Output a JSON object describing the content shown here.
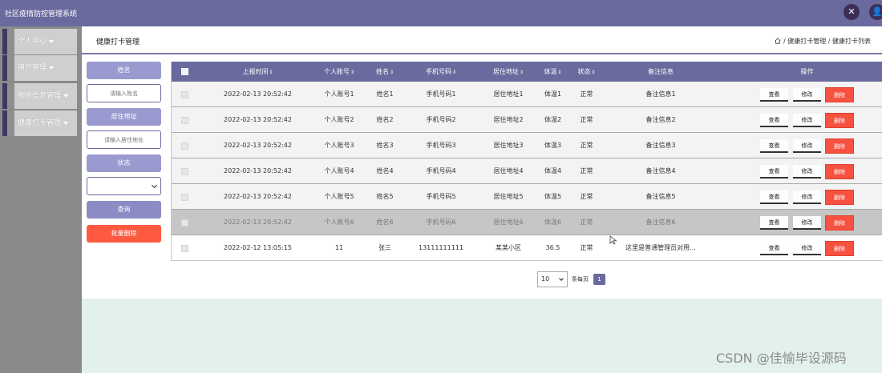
{
  "app": {
    "title": "社区疫情防控管理系统"
  },
  "top_icons": [
    {
      "icon": "expand-icon"
    },
    {
      "icon": "user-icon"
    }
  ],
  "sidebar": {
    "items": [
      {
        "label": "个人中心"
      },
      {
        "label": "用户管理"
      },
      {
        "label": "物资信息管理"
      },
      {
        "label": "健康打卡管理"
      }
    ]
  },
  "header": {
    "title": "健康打卡管理",
    "breadcrumb": "/ 健康打卡管理 / 健康打卡列表"
  },
  "search": {
    "name_label": "姓名",
    "name_placeholder": "请输入姓名",
    "address_label": "居住地址",
    "address_placeholder": "请输入居住地址",
    "status_label": "状态",
    "status_value": "",
    "query_button": "查询",
    "batch_delete_button": "批量删除"
  },
  "table": {
    "columns": [
      "上报时间",
      "个人账号",
      "姓名",
      "手机号码",
      "居住地址",
      "体温",
      "状态",
      "备注信息",
      "操作"
    ],
    "rows": [
      {
        "time": "2022-02-13 20:52:42",
        "account": "个人账号1",
        "name": "姓名1",
        "phone": "手机号码1",
        "address": "居住地址1",
        "temp": "体温1",
        "status": "正常",
        "note": "备注信息1"
      },
      {
        "time": "2022-02-13 20:52:42",
        "account": "个人账号2",
        "name": "姓名2",
        "phone": "手机号码2",
        "address": "居住地址2",
        "temp": "体温2",
        "status": "正常",
        "note": "备注信息2"
      },
      {
        "time": "2022-02-13 20:52:42",
        "account": "个人账号3",
        "name": "姓名3",
        "phone": "手机号码3",
        "address": "居住地址3",
        "temp": "体温3",
        "status": "正常",
        "note": "备注信息3"
      },
      {
        "time": "2022-02-13 20:52:42",
        "account": "个人账号4",
        "name": "姓名4",
        "phone": "手机号码4",
        "address": "居住地址4",
        "temp": "体温4",
        "status": "正常",
        "note": "备注信息4"
      },
      {
        "time": "2022-02-13 20:52:42",
        "account": "个人账号5",
        "name": "姓名5",
        "phone": "手机号码5",
        "address": "居住地址5",
        "temp": "体温5",
        "status": "正常",
        "note": "备注信息5"
      },
      {
        "time": "2022-02-13 20:52:42",
        "account": "个人账号6",
        "name": "姓名6",
        "phone": "手机号码6",
        "address": "居住地址6",
        "temp": "体温6",
        "status": "正常",
        "note": "备注信息6"
      },
      {
        "time": "2022-02-12 13:05:15",
        "account": "11",
        "name": "张三",
        "phone": "13111111111",
        "address": "某某小区",
        "temp": "36.5",
        "status": "正常",
        "note": "这里是普通管理员对用..."
      }
    ],
    "actions": {
      "view": "查看",
      "edit": "修改",
      "delete": "删除"
    }
  },
  "pagination": {
    "page_size": "10",
    "per_page_label": "条每页",
    "current_page": "1"
  },
  "watermark": "CSDN @佳愉毕设源码",
  "colors": {
    "primary": "#6a6a9e",
    "danger": "#f65141",
    "sidebar": "#8a8a8a",
    "footer": "#e3f1ee"
  }
}
